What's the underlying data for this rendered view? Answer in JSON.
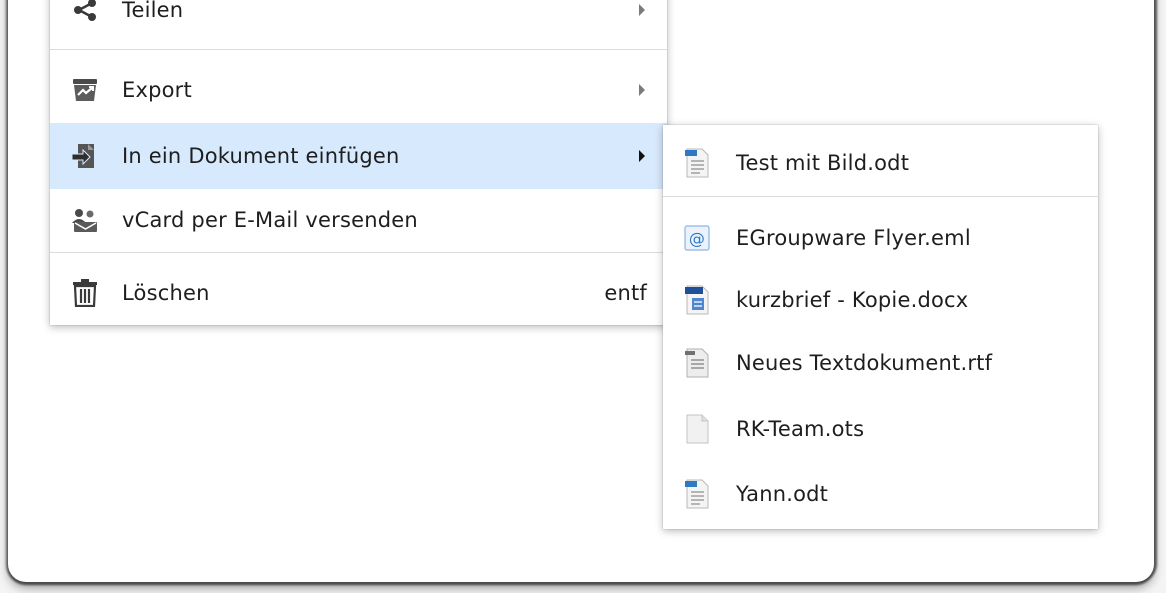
{
  "context_menu": {
    "items": [
      {
        "label": "Teilen",
        "icon": "share-icon",
        "has_submenu": true
      },
      {
        "label": "Export",
        "icon": "export-icon",
        "has_submenu": true
      },
      {
        "label": "In ein Dokument einfügen",
        "icon": "insert-document-icon",
        "has_submenu": true,
        "highlighted": true
      },
      {
        "label": "vCard per E-Mail versenden",
        "icon": "vcard-email-icon",
        "has_submenu": false
      },
      {
        "label": "Löschen",
        "icon": "trash-icon",
        "shortcut": "entf"
      }
    ]
  },
  "submenu": {
    "items": [
      {
        "label": "Test mit Bild.odt",
        "icon": "odt-file-icon"
      },
      {
        "label": "EGroupware Flyer.eml",
        "icon": "email-file-icon"
      },
      {
        "label": "kurzbrief - Kopie.docx",
        "icon": "docx-file-icon"
      },
      {
        "label": "Neues Textdokument.rtf",
        "icon": "rtf-file-icon"
      },
      {
        "label": "RK-Team.ots",
        "icon": "blank-file-icon"
      },
      {
        "label": "Yann.odt",
        "icon": "odt-file-icon"
      }
    ]
  },
  "colors": {
    "highlight": "#d7e9fc",
    "menu_background": "#ffffff",
    "separator": "#dcdcdc"
  }
}
